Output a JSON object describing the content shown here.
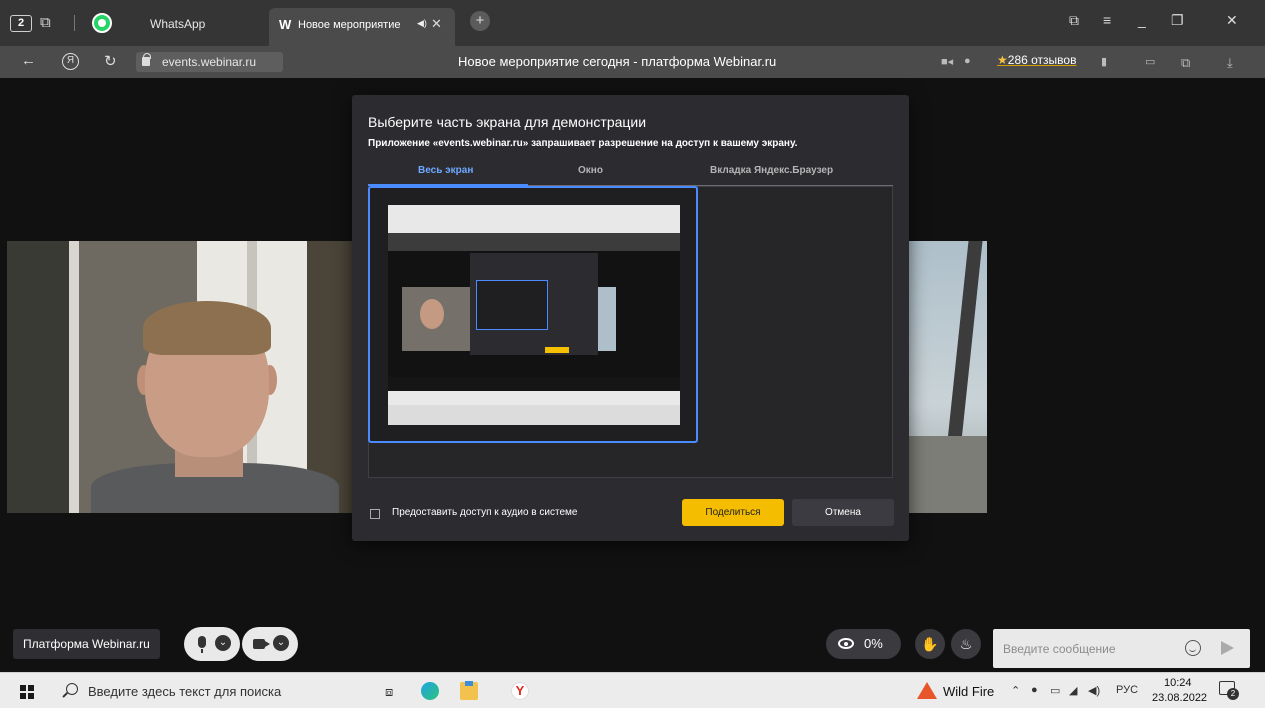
{
  "browser": {
    "tab_count": "2",
    "tabs": [
      {
        "label": "WhatsApp"
      },
      {
        "label": "Новое мероприятие",
        "logo": "W"
      }
    ],
    "url": "events.webinar.ru",
    "page_title": "Новое мероприятие сегодня - платформа Webinar.ru",
    "reviews": "286 отзывов"
  },
  "dialog": {
    "title": "Выберите часть экрана для демонстрации",
    "subtitle": "Приложение «events.webinar.ru» запрашивает разрешение на доступ к вашему экрану.",
    "tabs": [
      "Весь экран",
      "Окно",
      "Вкладка Яндекс.Браузер"
    ],
    "active_tab": 0,
    "audio_checkbox_label": "Предоставить доступ к аудио в системе",
    "audio_checked": false,
    "share_label": "Поделиться",
    "cancel_label": "Отмена",
    "accent_color": "#4a8cff",
    "share_color": "#f5bd00"
  },
  "webinar": {
    "platform_label": "Платформа Webinar.ru",
    "viewer_percent": "0%",
    "message_placeholder": "Введите сообщение"
  },
  "taskbar": {
    "search_placeholder": "Введите здесь текст для поиска",
    "weather": "Wild Fire",
    "language": "РУС",
    "time": "10:24",
    "date": "23.08.2022",
    "notifications": "2"
  }
}
